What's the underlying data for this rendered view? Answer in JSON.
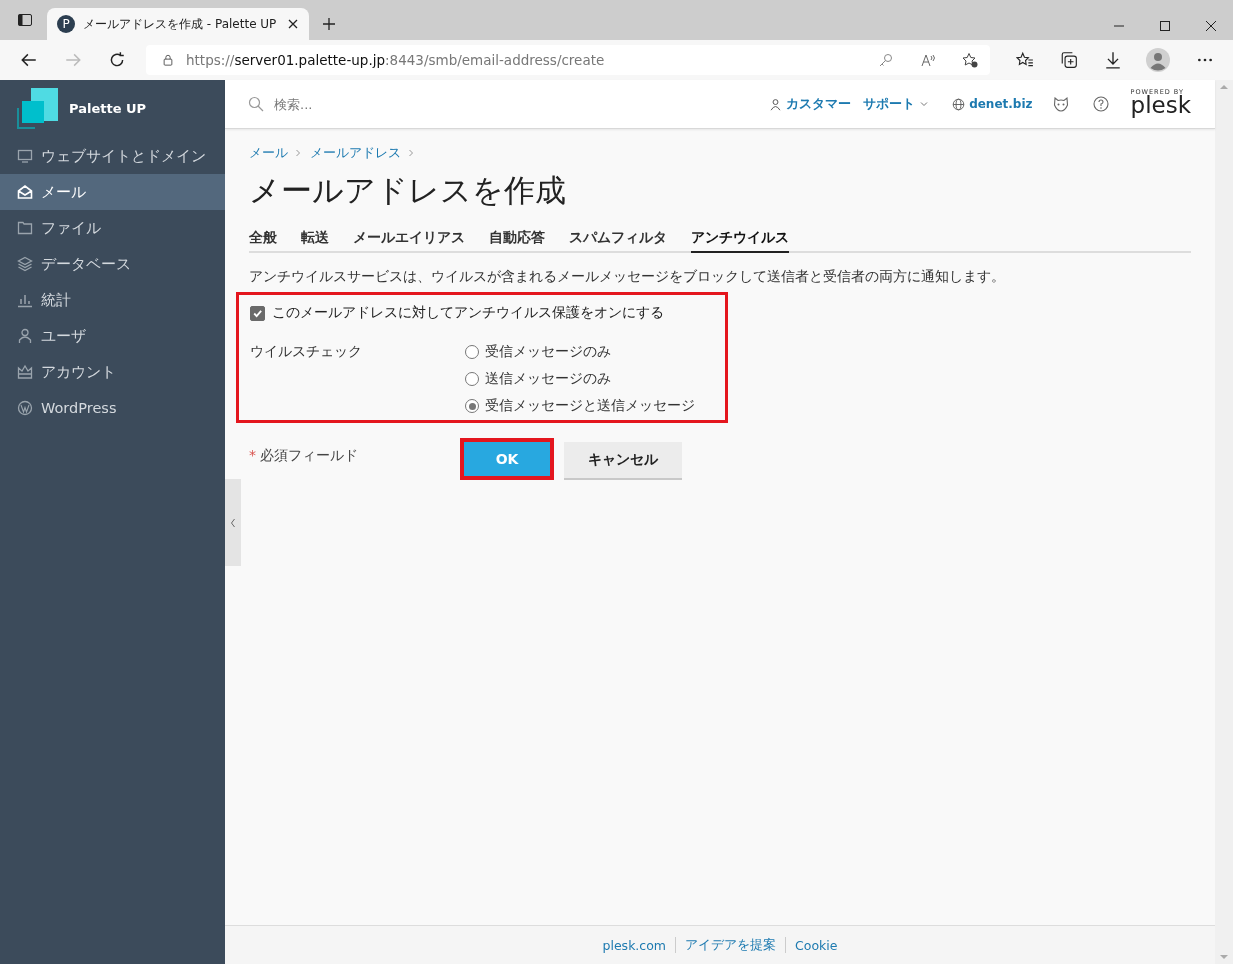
{
  "browser": {
    "tab_title": "メールアドレスを作成 - Palette UP",
    "favicon": "P",
    "url_scheme": "https://",
    "url_host": "server01.palette-up.jp",
    "url_path": ":8443/smb/email-address/create"
  },
  "sidebar": {
    "brand": "Palette UP",
    "items": [
      {
        "label": "ウェブサイトとドメイン",
        "selected": false
      },
      {
        "label": "メール",
        "selected": true
      },
      {
        "label": "ファイル",
        "selected": false
      },
      {
        "label": "データベース",
        "selected": false
      },
      {
        "label": "統計",
        "selected": false
      },
      {
        "label": "ユーザ",
        "selected": false
      },
      {
        "label": "アカウント",
        "selected": false
      },
      {
        "label": "WordPress",
        "selected": false
      }
    ]
  },
  "header": {
    "search": {
      "placeholder": "検索..."
    },
    "customer": "カスタマー",
    "support": "サポート",
    "domain": "denet.biz",
    "powered_by": "POWERED BY",
    "logo": "plesk"
  },
  "breadcrumbs": [
    "メール",
    "メールアドレス"
  ],
  "title": "メールアドレスを作成",
  "tabs": [
    {
      "label": "全般",
      "selected": false
    },
    {
      "label": "転送",
      "selected": false
    },
    {
      "label": "メールエイリアス",
      "selected": false
    },
    {
      "label": "自動応答",
      "selected": false
    },
    {
      "label": "スパムフィルタ",
      "selected": false
    },
    {
      "label": "アンチウイルス",
      "selected": true
    }
  ],
  "description": "アンチウイルスサービスは、ウイルスが含まれるメールメッセージをブロックして送信者と受信者の両方に通知します。",
  "antivirus_toggle": {
    "label": "このメールアドレスに対してアンチウイルス保護をオンにする",
    "checked": true
  },
  "virus_check": {
    "label": "ウイルスチェック",
    "options": [
      {
        "label": "受信メッセージのみ",
        "selected": false
      },
      {
        "label": "送信メッセージのみ",
        "selected": false
      },
      {
        "label": "受信メッセージと送信メッセージ",
        "selected": true
      }
    ]
  },
  "required_note": {
    "mark": "*",
    "text": "必須フィールド"
  },
  "buttons": {
    "ok": "OK",
    "cancel": "キャンセル"
  },
  "footer": [
    "plesk.com",
    "アイデアを提案",
    "Cookie"
  ]
}
